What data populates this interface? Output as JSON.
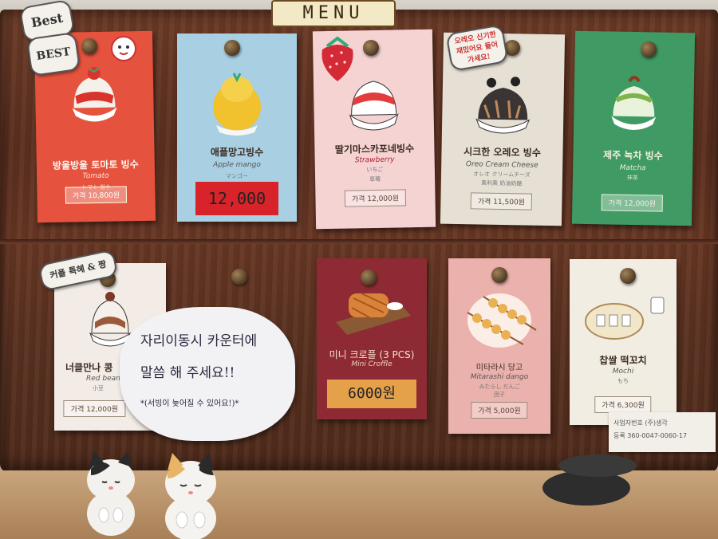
{
  "sign": {
    "title": "MENU"
  },
  "tags": {
    "best1": "Best",
    "best2": "BEST",
    "couple": "커플 특혜 & 짱",
    "oreo_note": "오레오 신기한 재밌어요 들어가세요!"
  },
  "cards": [
    {
      "name": "방울방울 토마토 빙수",
      "en": "Tomato",
      "jp": "トマト 빙수",
      "price": "가격 10,800원",
      "color": "#e5523d"
    },
    {
      "name": "애플망고빙수",
      "en": "Apple mango",
      "jp": "マンゴー",
      "price": "12,000",
      "color": "#a9cfe3"
    },
    {
      "name": "딸기마스카포네빙수",
      "en": "Strawberry",
      "jp": "いちご",
      "jp2": "草莓",
      "price": "가격 12,000원",
      "color": "#f5d3d3"
    },
    {
      "name": "시크한 오레오 빙수",
      "en": "Oreo Cream Cheese",
      "jp": "オレオ クリームチーズ",
      "jp2": "奥利奥 奶油奶酪",
      "price": "가격 11,500원",
      "color": "#e6e0d4"
    },
    {
      "name": "제주 녹차 빙수",
      "en": "Matcha",
      "jp": "抹茶",
      "price": "가격 12,000원",
      "color": "#3f9a63"
    },
    {
      "name": "너클만나 콩",
      "en": "Red bean",
      "jp": "小豆",
      "price": "가격 12,000원",
      "color": "#f3ece6"
    },
    {
      "name": "미니 크로플 (3 PCS)",
      "en": "Mini Croffle",
      "price": "6000원",
      "color": "#8e2a33"
    },
    {
      "name": "미타라시 당고",
      "en": "Mitarashi dango",
      "jp": "みたらし だんご",
      "jp2": "团子",
      "price": "가격 5,000원",
      "color": "#ebb1ac"
    },
    {
      "name": "찹쌀 떡꼬치",
      "en": "Mochi",
      "jp": "もち",
      "price": "가격 6,300원",
      "color": "#f1ede2"
    }
  ],
  "note": {
    "line1": "자리이동시 카운터에",
    "line2": "말씀 해 주세요!!",
    "line3": "*(서빙이 늦어질 수 있어요!)*"
  },
  "address": {
    "line1": "사업자번호 (주)생각",
    "line2": "등록 360-0047-0060-17"
  }
}
